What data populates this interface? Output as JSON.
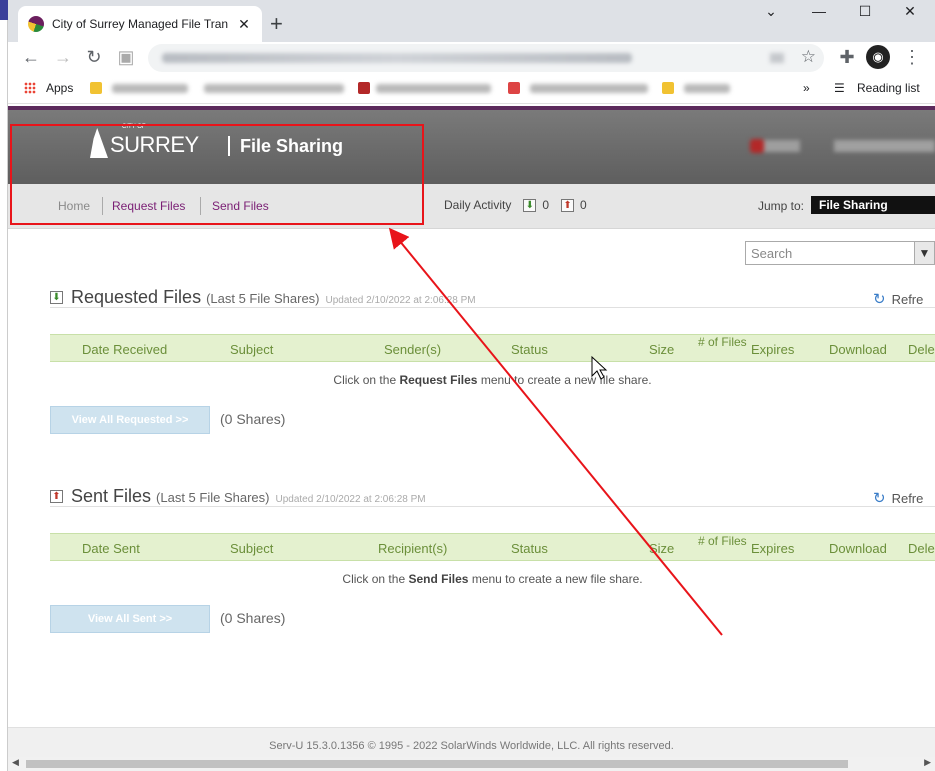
{
  "browser": {
    "tab_title": "City of Surrey Managed File Tran",
    "new_tab_symbol": "+",
    "bookmarks_apps": "Apps",
    "reading_list": "Reading list",
    "window_controls": {
      "minimize": "—",
      "maximize": "☐",
      "close": "✕",
      "tab_list": "⌄"
    }
  },
  "site": {
    "logo_text": "SURREY",
    "logo_small": "CITY OF",
    "header_title": "File Sharing"
  },
  "subnav": {
    "home": "Home",
    "request_files": "Request Files",
    "send_files": "Send Files",
    "daily_activity": "Daily Activity",
    "incoming_count": "0",
    "outgoing_count": "0",
    "jump_to_label": "Jump to:",
    "jump_to_value": "File Sharing"
  },
  "search": {
    "placeholder": "Search"
  },
  "requested": {
    "title": "Requested Files",
    "subtitle": "(Last 5 File Shares)",
    "updated": "Updated 2/10/2022 at 2:06:28 PM",
    "refresh": "Refre",
    "columns": [
      "Date Received",
      "Subject",
      "Sender(s)",
      "Status",
      "Size",
      "# of Files",
      "Expires",
      "Download",
      "Dele"
    ],
    "empty_pre": "Click on the ",
    "empty_bold": "Request Files",
    "empty_post": " menu to create a new file share.",
    "view_all": "View All Requested >>",
    "share_count": "(0 Shares)"
  },
  "sent": {
    "title": "Sent Files",
    "subtitle": "(Last 5 File Shares)",
    "updated": "Updated 2/10/2022 at 2:06:28 PM",
    "refresh": "Refre",
    "columns": [
      "Date Sent",
      "Subject",
      "Recipient(s)",
      "Status",
      "Size",
      "# of Files",
      "Expires",
      "Download",
      "Dele"
    ],
    "empty_pre": "Click on the ",
    "empty_bold": "Send Files",
    "empty_post": " menu to create a new file share.",
    "view_all": "View All Sent >>",
    "share_count": "(0 Shares)"
  },
  "footer": {
    "text": "Serv-U 15.3.0.1356 © 1995 - 2022 SolarWinds Worldwide, LLC. All rights reserved."
  },
  "colors": {
    "brand_purple": "#7a1e74",
    "annotation_red": "#e8141a",
    "table_header": "#e4f1cf"
  }
}
